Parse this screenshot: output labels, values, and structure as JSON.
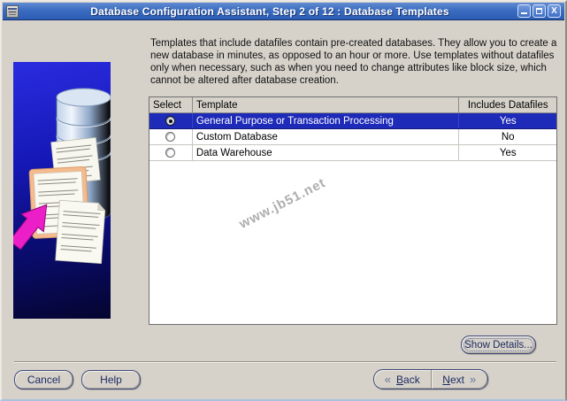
{
  "window": {
    "title": "Database Configuration Assistant, Step 2 of 12 : Database Templates"
  },
  "description": "Templates that include datafiles contain pre-created databases. They allow you to create a\nnew database in minutes, as opposed to an hour or more. Use templates without datafiles\nonly when necessary, such as when you need to change attributes like block size, which\ncannot be altered after database creation.",
  "table": {
    "headers": [
      "Select",
      "Template",
      "Includes Datafiles"
    ],
    "rows": [
      {
        "selected": true,
        "template": "General Purpose or Transaction Processing",
        "includes_datafiles": "Yes"
      },
      {
        "selected": false,
        "template": "Custom Database",
        "includes_datafiles": "No"
      },
      {
        "selected": false,
        "template": "Data Warehouse",
        "includes_datafiles": "Yes"
      }
    ]
  },
  "watermark": "www.jb51.net",
  "buttons": {
    "show_details": "Show Details...",
    "cancel": "Cancel",
    "help": "Help",
    "back": "Back",
    "next": "Next",
    "back_chevron": "«",
    "next_chevron": "»"
  },
  "colors": {
    "titlebar_blue": "#3a6cc0",
    "selection_blue": "#1e2ab8",
    "panel_blue_top": "#2a2ce0",
    "panel_blue_bottom": "#05052f",
    "window_gray": "#d6d2ca",
    "button_navy": "#1e2a62",
    "arrow_magenta": "#ec1ec8",
    "watermark_gray": "#aeaeae"
  }
}
